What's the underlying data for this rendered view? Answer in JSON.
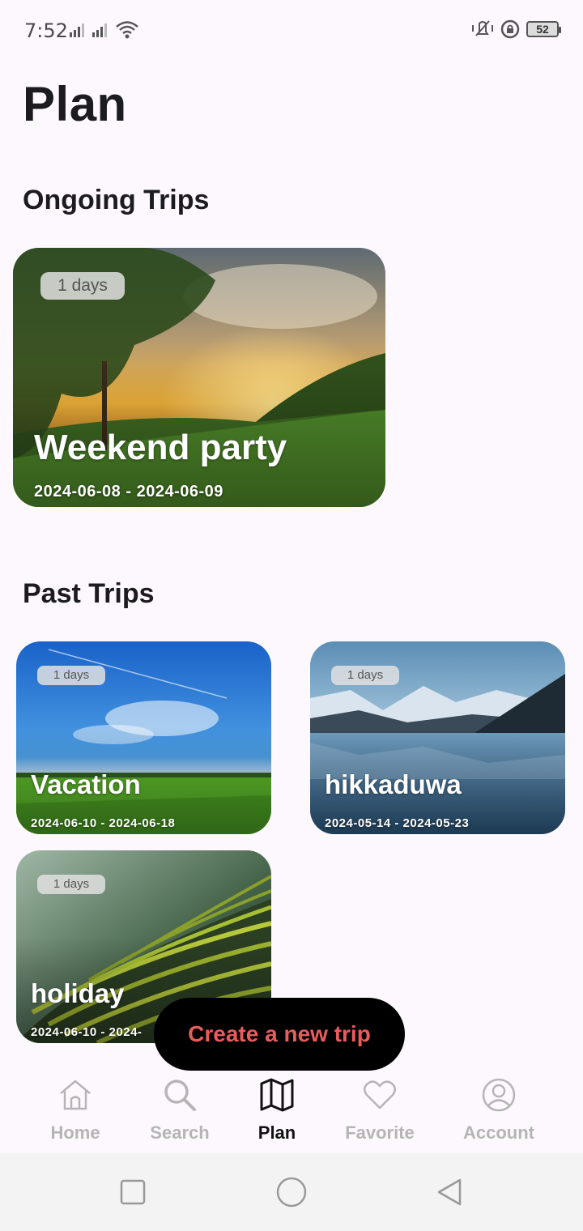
{
  "status_bar": {
    "time": "7:52",
    "battery": "52"
  },
  "page": {
    "title": "Plan"
  },
  "sections": {
    "ongoing": "Ongoing Trips",
    "past": "Past Trips"
  },
  "ongoing_trips": [
    {
      "name": "Weekend party",
      "duration": "1 days",
      "dates": "2024-06-08 - 2024-06-09"
    }
  ],
  "past_trips": [
    {
      "name": "Vacation",
      "duration": "1 days",
      "dates": "2024-06-10 - 2024-06-18"
    },
    {
      "name": "hikkaduwa",
      "duration": "1 days",
      "dates": "2024-05-14 - 2024-05-23"
    },
    {
      "name": "holiday",
      "duration": "1 days",
      "dates": "2024-06-10 - 2024-"
    }
  ],
  "create_button": {
    "label": "Create a new trip",
    "color": "#e85c5c"
  },
  "bottom_nav": {
    "active": "Plan",
    "items": [
      {
        "label": "Home",
        "icon": "home-icon"
      },
      {
        "label": "Search",
        "icon": "search-icon"
      },
      {
        "label": "Plan",
        "icon": "map-icon"
      },
      {
        "label": "Favorite",
        "icon": "heart-icon"
      },
      {
        "label": "Account",
        "icon": "account-icon"
      }
    ]
  },
  "system_nav": {
    "icons": [
      "recents-icon",
      "home-circle-icon",
      "back-triangle-icon"
    ]
  }
}
